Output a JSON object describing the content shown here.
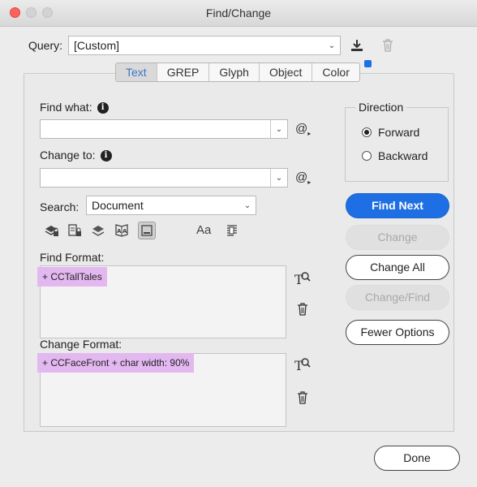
{
  "window": {
    "title": "Find/Change"
  },
  "query": {
    "label": "Query:",
    "value": "[Custom]"
  },
  "tabs": [
    {
      "label": "Text",
      "active": true
    },
    {
      "label": "GREP",
      "active": false
    },
    {
      "label": "Glyph",
      "active": false
    },
    {
      "label": "Object",
      "active": false
    },
    {
      "label": "Color",
      "active": false
    }
  ],
  "find": {
    "label": "Find what:",
    "value": ""
  },
  "change": {
    "label": "Change to:",
    "value": ""
  },
  "special_char_glyph": "@",
  "search": {
    "label": "Search:",
    "value": "Document"
  },
  "find_format": {
    "label": "Find Format:",
    "tag": "+ CCTallTales"
  },
  "change_format": {
    "label": "Change Format:",
    "tag": "+ CCFaceFront + char width: 90%"
  },
  "direction": {
    "label": "Direction",
    "options": [
      {
        "label": "Forward",
        "selected": true
      },
      {
        "label": "Backward",
        "selected": false
      }
    ]
  },
  "buttons": {
    "find_next": "Find Next",
    "change": "Change",
    "change_all": "Change All",
    "change_find": "Change/Find",
    "fewer_options": "Fewer Options",
    "done": "Done"
  },
  "search_options_icons": [
    "locked-layers-icon",
    "locked-stories-icon",
    "hidden-layers-icon",
    "master-pages-icon",
    "footnotes-icon",
    "case-sensitive-icon",
    "whole-word-icon"
  ],
  "case_glyph": "Aa",
  "colors": {
    "accent": "#1e6fe3",
    "highlight": "#e3b8f0",
    "active_tab_text": "#3a78c4"
  }
}
